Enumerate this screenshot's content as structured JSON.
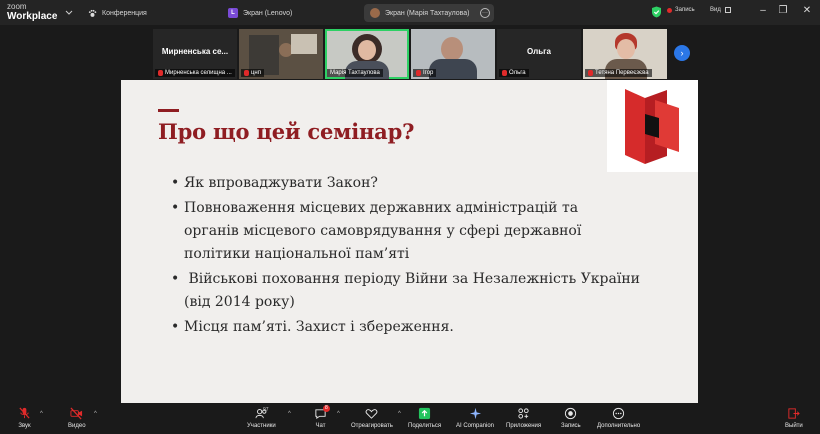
{
  "app": {
    "brand_top": "zoom",
    "brand_bottom": "Workplace"
  },
  "tabs": [
    {
      "label": "Конференция",
      "icon": "paw-icon"
    },
    {
      "label": "Экран (Lenovo)",
      "icon_letter": "L"
    },
    {
      "label": "Экран (Марія Тахтаулова)",
      "icon": "avatar-icon"
    }
  ],
  "titlebar": {
    "record_label": "Запись",
    "view_label": "Вид"
  },
  "participants": [
    {
      "big_name": "Мирненська се...",
      "label": "Мирненська селищна ..."
    },
    {
      "big_name": "",
      "label": "цнп"
    },
    {
      "big_name": "",
      "label": "Марія Тахтаулова"
    },
    {
      "big_name": "",
      "label": "Ігор"
    },
    {
      "big_name": "Ольга",
      "label": "Ольга"
    },
    {
      "big_name": "",
      "label": "Тетяна Первеєзєва"
    }
  ],
  "slide": {
    "title": "Про що цей семінар?",
    "bullets": [
      {
        "lines": [
          "Як впроваджувати Закон?"
        ]
      },
      {
        "lines": [
          "Повноваження місцевих державних адміністрацій та",
          "органів місцевого самоврядування у сфері державної",
          "політики національної пам’яті"
        ]
      },
      {
        "lines": [
          " Військові поховання періоду Війни за Незалежність України",
          "(від 2014 року)"
        ]
      },
      {
        "lines": [
          "Місця пам’яті. Захист і збереження."
        ]
      }
    ]
  },
  "toolbar": {
    "audio": "Звук",
    "video": "Видео",
    "participants": "Участники",
    "participants_count": "97",
    "chat": "Чат",
    "chat_badge": "8",
    "react": "Отреагировать",
    "share": "Поделиться",
    "ai": "AI Companion",
    "apps": "Приложения",
    "record": "Запись",
    "more": "Дополнительно",
    "leave": "Выйти"
  },
  "colors": {
    "accent_red": "#8f1d22",
    "speaking_green": "#2ed064",
    "share_green": "#23c45e",
    "danger": "#e02a2a",
    "blue": "#2b77e7"
  }
}
